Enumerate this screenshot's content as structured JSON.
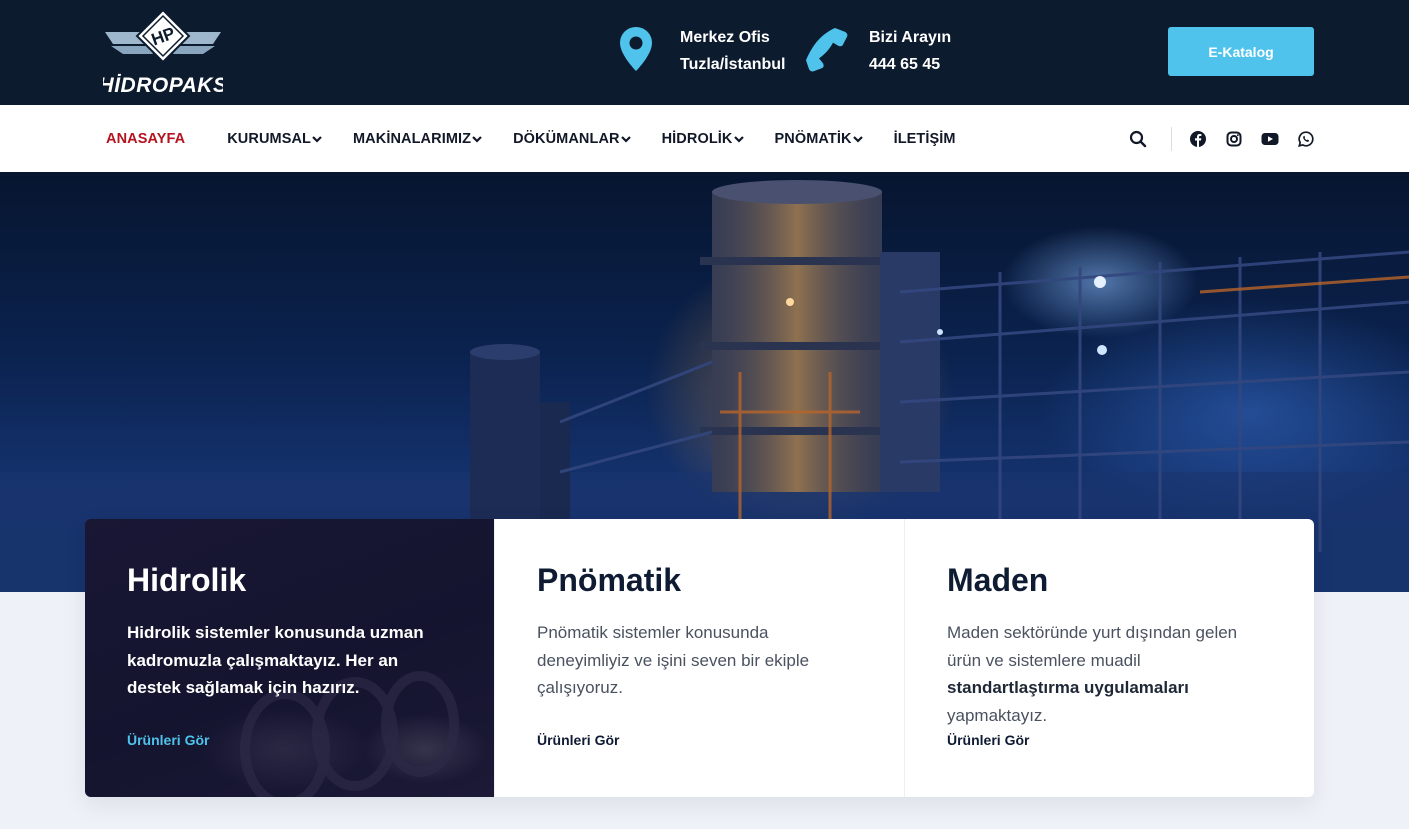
{
  "header": {
    "logo_text": "HİDROPAKS",
    "logo_badge": "HP",
    "office": {
      "title": "Merkez Ofis",
      "value": "Tuzla/İstanbul",
      "icon": "map-pin-icon"
    },
    "phone": {
      "title": "Bizi Arayın",
      "value": "444 65 45",
      "icon": "phone-icon"
    },
    "catalog_button": "E-Katalog"
  },
  "nav": {
    "items": [
      {
        "label": "ANASAYFA",
        "active": true,
        "dropdown": false
      },
      {
        "label": "KURUMSAL",
        "active": false,
        "dropdown": true
      },
      {
        "label": "MAKİNALARIMIZ",
        "active": false,
        "dropdown": true
      },
      {
        "label": "DÖKÜMANLAR",
        "active": false,
        "dropdown": true
      },
      {
        "label": "HİDROLİK",
        "active": false,
        "dropdown": true
      },
      {
        "label": "PNÖMATİK",
        "active": false,
        "dropdown": true
      },
      {
        "label": "İLETİŞİM",
        "active": false,
        "dropdown": false
      }
    ],
    "social": [
      "facebook-icon",
      "instagram-icon",
      "youtube-icon",
      "whatsapp-icon"
    ]
  },
  "cards": [
    {
      "title": "Hidrolik",
      "text": "Hidrolik sistemler konusunda uzman kadromuzla çalışmaktayız. Her an destek sağlamak için hazırız.",
      "link": "Ürünleri Gör"
    },
    {
      "title": "Pnömatik",
      "text": "Pnömatik sistemler konusunda deneyimliyiz ve işini seven bir ekiple çalışıyoruz.",
      "link": "Ürünleri Gör"
    },
    {
      "title": "Maden",
      "text_before": "Maden sektöründe yurt dışından gelen ürün ve sistemlere muadil",
      "text_bold": "standartlaştırma uygulamaları",
      "text_after": "yapmaktayız.",
      "link": "Ürünleri Gör"
    }
  ],
  "colors": {
    "topbar": "#0d1b2e",
    "accent": "#4fc3eb",
    "active_nav": "#b3141f",
    "page_bg": "#eef1f7"
  }
}
